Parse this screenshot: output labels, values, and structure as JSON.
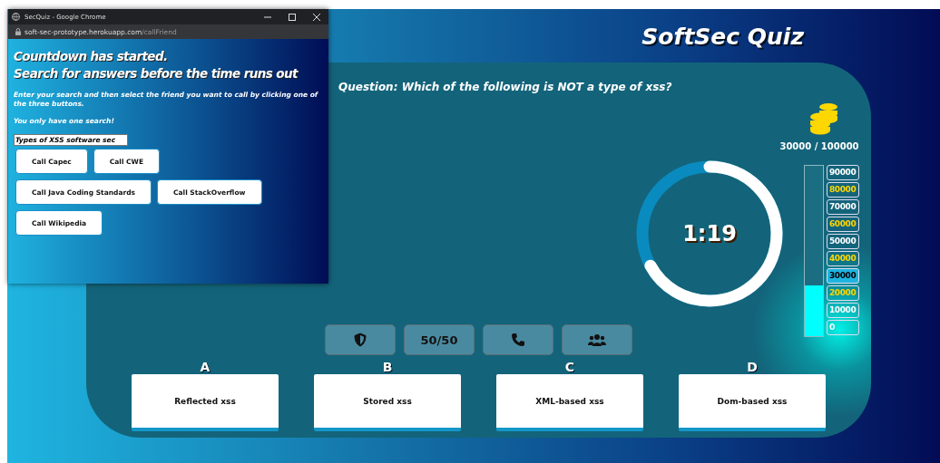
{
  "popup": {
    "title": "SecQuiz - Google Chrome",
    "url_host": "soft-sec-prototype.herokuapp.com",
    "url_path": "/callFriend",
    "heading_lines": [
      "Countdown has started.",
      "Search for answers before the time runs out"
    ],
    "instruction": "Enter your search and then select the friend you want to call by clicking one of the three buttons.",
    "note": "You only have one search!",
    "search_value": "Types of XSS software sec",
    "buttons": [
      [
        "Call Capec",
        "Call CWE"
      ],
      [
        "Call Java Coding Standards",
        "Call StackOverflow"
      ],
      [
        "Call Wikipedia"
      ]
    ]
  },
  "quiz": {
    "title": "SoftSec Quiz",
    "question": "Question: Which of the following is NOT a type of xss?",
    "coins": "30000 / 100000",
    "timer": {
      "text": "1:19",
      "level": 0.67
    },
    "ladder": {
      "level": 0.3,
      "steps": [
        {
          "label": "90000",
          "color": "#ffffff",
          "selected": false
        },
        {
          "label": "80000",
          "color": "#ffd700",
          "selected": false
        },
        {
          "label": "70000",
          "color": "#ffffff",
          "selected": false
        },
        {
          "label": "60000",
          "color": "#ffd700",
          "selected": false
        },
        {
          "label": "50000",
          "color": "#ffffff",
          "selected": false
        },
        {
          "label": "40000",
          "color": "#ffd700",
          "selected": false
        },
        {
          "label": "30000",
          "color": "#000000",
          "selected": true
        },
        {
          "label": "20000",
          "color": "#ffd700",
          "selected": false
        },
        {
          "label": "10000",
          "color": "#ffffff",
          "selected": false
        },
        {
          "label": "0",
          "color": "#ffffff",
          "selected": false
        }
      ]
    },
    "lifelines": [
      {
        "kind": "shield"
      },
      {
        "kind": "text",
        "label": "50/50"
      },
      {
        "kind": "phone"
      },
      {
        "kind": "group"
      }
    ],
    "answers": [
      {
        "letter": "A",
        "text": "Reflected xss"
      },
      {
        "letter": "B",
        "text": "Stored xss"
      },
      {
        "letter": "C",
        "text": "XML-based xss"
      },
      {
        "letter": "D",
        "text": "Dom-based xss"
      }
    ]
  }
}
